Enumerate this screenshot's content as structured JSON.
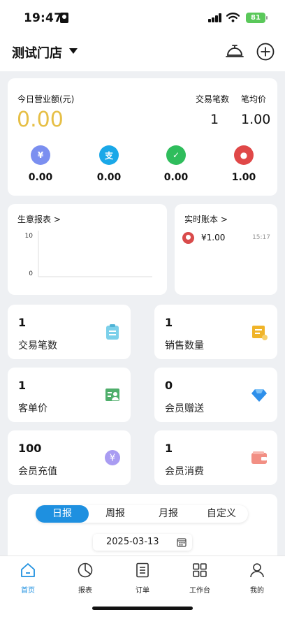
{
  "status_bar": {
    "time": "19:47",
    "battery": "81"
  },
  "header": {
    "store_name": "测试门店",
    "icons": [
      "service-bell-icon",
      "add-circle-icon"
    ]
  },
  "today": {
    "revenue_label": "今日营业额(元)",
    "revenue_value": "0.00",
    "transactions_label": "交易笔数",
    "transactions_value": "1",
    "avg_label": "笔均价",
    "avg_value": "1.00",
    "payments": [
      {
        "icon": "yuan-icon",
        "value": "0.00",
        "color": "#7b8ff0"
      },
      {
        "icon": "alipay-icon",
        "value": "0.00",
        "color": "#1aa8e8"
      },
      {
        "icon": "wechat-icon",
        "value": "0.00",
        "color": "#2fbd5c"
      },
      {
        "icon": "member-card-icon",
        "value": "1.00",
        "color": "#e04848"
      }
    ]
  },
  "business_report": {
    "title": "生意报表 >",
    "chart_data": {
      "type": "line",
      "title": "",
      "xlabel": "",
      "ylabel": "",
      "y_ticks": [
        "10",
        "0"
      ],
      "ylim": [
        0,
        10
      ],
      "series": []
    }
  },
  "ledger": {
    "title": "实时账本 >",
    "entries": [
      {
        "amount": "¥1.00",
        "time": "15:17"
      }
    ]
  },
  "stats": [
    {
      "value": "1",
      "label": "交易笔数",
      "icon": "clipboard-icon",
      "color": "#7cd0ea"
    },
    {
      "value": "1",
      "label": "销售数量",
      "icon": "sales-list-icon",
      "color": "#f0b429"
    },
    {
      "value": "1",
      "label": "客单价",
      "icon": "customer-card-icon",
      "color": "#4fae6b"
    },
    {
      "value": "0",
      "label": "会员赠送",
      "icon": "diamond-icon",
      "color": "#2e8fea"
    },
    {
      "value": "100",
      "label": "会员充值",
      "icon": "yuan-coin-icon",
      "color": "#a99cf2"
    },
    {
      "value": "1",
      "label": "会员消费",
      "icon": "wallet-icon",
      "color": "#f28f84"
    }
  ],
  "report_tabs": [
    "日报",
    "周报",
    "月报",
    "自定义"
  ],
  "active_report_tab": "日报",
  "date": "2025-03-13",
  "tabbar": [
    {
      "label": "首页",
      "icon": "home-icon",
      "active": true
    },
    {
      "label": "报表",
      "icon": "pie-chart-icon",
      "active": false
    },
    {
      "label": "订单",
      "icon": "order-list-icon",
      "active": false
    },
    {
      "label": "工作台",
      "icon": "workbench-grid-icon",
      "active": false
    },
    {
      "label": "我的",
      "icon": "profile-icon",
      "active": false
    }
  ],
  "colors": {
    "accent": "#1e90e0",
    "revenue": "#e6bf46"
  }
}
